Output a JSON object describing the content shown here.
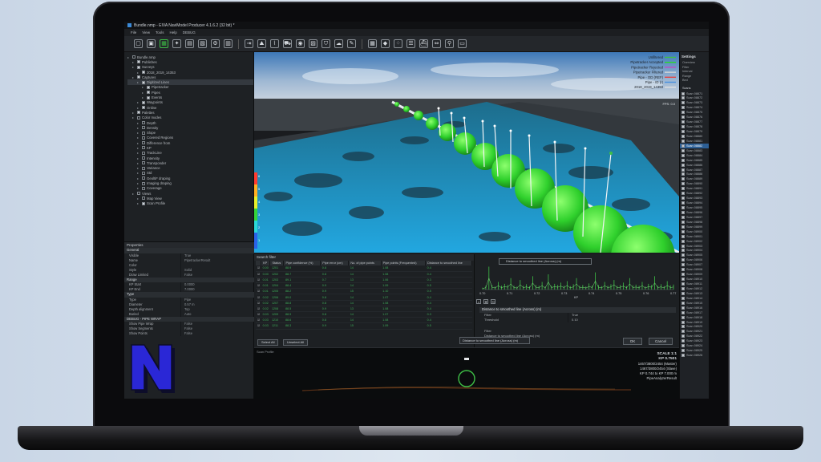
{
  "window": {
    "title": "Bundle.nmp - EIVA NaviModel Producer 4.1.6.2 (32 bit) *"
  },
  "menu": [
    "File",
    "View",
    "Tools",
    "Help",
    "DEBUG"
  ],
  "toolbar_icons": [
    "new-file-icon",
    "open-icon",
    "layers-icon",
    "satellite-icon",
    "chart-icon",
    "cube-icon",
    "settings-icon",
    "grid-icon",
    "import-icon",
    "terrain-icon",
    "profile-icon",
    "car-icon",
    "camera-icon",
    "image-icon",
    "shield-icon",
    "cloud-icon",
    "brush-icon",
    "table-icon",
    "diamond-icon",
    "dots-icon",
    "sky-icon",
    "vessel-icon",
    "measure-icon",
    "pin-icon",
    "frame-icon"
  ],
  "tree": [
    {
      "label": "Bundle.nmp",
      "level": 0,
      "check": false
    },
    {
      "label": "Publishes",
      "level": 1,
      "check": true
    },
    {
      "label": "Surveys",
      "level": 1,
      "check": true
    },
    {
      "label": "2018_2019_14353",
      "level": 2,
      "check": true
    },
    {
      "label": "Captures",
      "level": 1,
      "check": true
    },
    {
      "label": "Digitized Lines",
      "level": 2,
      "check": true,
      "selected": true
    },
    {
      "label": "Pipetracker",
      "level": 3,
      "check": true
    },
    {
      "label": "Pipes",
      "level": 3,
      "check": true
    },
    {
      "label": "Events",
      "level": 3,
      "check": true
    },
    {
      "label": "Waypoints",
      "level": 2,
      "check": true
    },
    {
      "label": "Online",
      "level": 2,
      "check": true
    },
    {
      "label": "Palettes",
      "level": 1,
      "check": true
    },
    {
      "label": "Color modes",
      "level": 1,
      "check": false
    },
    {
      "label": "Depth",
      "level": 2,
      "check": false
    },
    {
      "label": "Density",
      "level": 2,
      "check": false
    },
    {
      "label": "Slope",
      "level": 2,
      "check": false
    },
    {
      "label": "Covered Regions",
      "level": 2,
      "check": false
    },
    {
      "label": "Difference from",
      "level": 2,
      "check": false
    },
    {
      "label": "KP",
      "level": 2,
      "check": false
    },
    {
      "label": "TrackLine",
      "level": 2,
      "check": false
    },
    {
      "label": "Intensity",
      "level": 2,
      "check": false
    },
    {
      "label": "Transponder",
      "level": 2,
      "check": false
    },
    {
      "label": "Variance",
      "level": 2,
      "check": false
    },
    {
      "label": "Std",
      "level": 2,
      "check": false
    },
    {
      "label": "GeoltiF draping",
      "level": 2,
      "check": false
    },
    {
      "label": "Imaging draping",
      "level": 2,
      "check": false
    },
    {
      "label": "Coverage",
      "level": 2,
      "check": false
    },
    {
      "label": "Views",
      "level": 1,
      "check": false
    },
    {
      "label": "Map View",
      "level": 2,
      "check": false
    },
    {
      "label": "Scan Profile",
      "level": 2,
      "check": true
    }
  ],
  "properties": {
    "title": "Properties",
    "sections": [
      {
        "name": "General",
        "rows": [
          [
            "Visible",
            "True"
          ],
          [
            "Name",
            "PipetrackerResult"
          ],
          [
            "Color",
            ""
          ],
          [
            "Style",
            "Solid"
          ],
          [
            "Draw Limited",
            "False"
          ]
        ]
      },
      {
        "name": "Range",
        "rows": [
          [
            "KP Start",
            "0.0000"
          ],
          [
            "KP End",
            "7.0000"
          ]
        ]
      },
      {
        "name": "Type",
        "rows": [
          [
            "Type",
            "Pipe"
          ],
          [
            "Diameter",
            "0.57 m"
          ],
          [
            "Depth alignment",
            "Top"
          ],
          [
            "Buried",
            "Auto"
          ]
        ]
      },
      {
        "name": "DEBUG - PIPE WRAP",
        "rows": [
          [
            "Show Pipe Wrap",
            "False"
          ],
          [
            "Show Segments",
            "False"
          ],
          [
            "Show Points",
            "False"
          ]
        ]
      }
    ]
  },
  "viewport_legend": [
    "Unfiltered",
    "Pipetracker Accepted",
    "Pipetracker Rejected",
    "Pipetracker Filtered",
    "Pipe - OD (REF)",
    "Pipe - ID (r)",
    "2018_2019_14353"
  ],
  "viewport_fps": "FPS: 0.0",
  "viewport_scale_labels": [
    "6",
    "5",
    "4",
    "3",
    "2",
    "1"
  ],
  "right_panel": {
    "header": "Settings",
    "rows": [
      "Overview",
      "Filter",
      "Interval",
      "Range",
      "Bed"
    ],
    "scans_label": "Scans",
    "scans": [
      "Scan 08871",
      "Scan 08872",
      "Scan 08873",
      "Scan 08874",
      "Scan 08875",
      "Scan 08876",
      "Scan 08877",
      "Scan 08878",
      "Scan 08879",
      "Scan 08880",
      "Scan 08881",
      "Scan 08882",
      "Scan 08883",
      "Scan 08884",
      "Scan 08885",
      "Scan 08886",
      "Scan 08887",
      "Scan 08888",
      "Scan 08889",
      "Scan 08890",
      "Scan 08891",
      "Scan 08892",
      "Scan 08893",
      "Scan 08894",
      "Scan 08895",
      "Scan 08896",
      "Scan 08897",
      "Scan 08898",
      "Scan 08899",
      "Scan 08900",
      "Scan 08901",
      "Scan 08902",
      "Scan 08903",
      "Scan 08904",
      "Scan 08905",
      "Scan 08906",
      "Scan 08907",
      "Scan 08908",
      "Scan 08909",
      "Scan 08910",
      "Scan 08911",
      "Scan 08912",
      "Scan 08913",
      "Scan 08914",
      "Scan 08915",
      "Scan 08916",
      "Scan 08917",
      "Scan 08918",
      "Scan 08919",
      "Scan 08920",
      "Scan 08921",
      "Scan 08922",
      "Scan 08923",
      "Scan 08924",
      "Scan 08925",
      "Scan 08926"
    ]
  },
  "search_filter": {
    "title": "Search filter",
    "columns": [
      "KP",
      "Status",
      "Pipe confidence (%)",
      "Pipe error (cm)",
      "No. of pipe points",
      "Pipe points (Frequented)",
      "Distance to smoothed line"
    ],
    "rows": [
      [
        "0.00",
        "1201",
        "88.9",
        "0.8",
        "14",
        "1.08",
        "0.4"
      ],
      [
        "0.00",
        "1202",
        "88.7",
        "0.8",
        "14",
        "1.08",
        "0.4"
      ],
      [
        "0.01",
        "1203",
        "89.1",
        "0.7",
        "13",
        "1.06",
        "0.3"
      ],
      [
        "0.01",
        "1204",
        "88.4",
        "0.9",
        "14",
        "1.09",
        "0.5"
      ],
      [
        "0.01",
        "1205",
        "88.2",
        "0.9",
        "15",
        "1.10",
        "0.5"
      ],
      [
        "0.02",
        "1206",
        "89.0",
        "0.8",
        "14",
        "1.07",
        "0.4"
      ],
      [
        "0.02",
        "1207",
        "88.8",
        "0.8",
        "14",
        "1.08",
        "0.4"
      ],
      [
        "0.02",
        "1208",
        "88.5",
        "0.9",
        "13",
        "1.08",
        "0.4"
      ],
      [
        "0.03",
        "1209",
        "88.9",
        "0.8",
        "14",
        "1.07",
        "0.3"
      ],
      [
        "0.03",
        "1210",
        "88.6",
        "0.8",
        "14",
        "1.08",
        "0.4"
      ],
      [
        "0.03",
        "1211",
        "88.3",
        "0.9",
        "15",
        "1.09",
        "0.5"
      ]
    ],
    "select_all": "Select All",
    "unselect_all": "Unselect All"
  },
  "graph": {
    "legend": "Distance to smoothed line (Across) (m)",
    "x_ticks": [
      "0.70",
      "0.71",
      "0.72",
      "0.73",
      "0.74",
      "0.75",
      "0.76",
      "0.77"
    ],
    "x_label": "KP",
    "values": [
      0.05,
      0.1,
      0.6,
      0.12,
      0.08,
      0.2,
      0.1,
      0.15,
      0.12,
      0.3,
      0.1,
      0.08,
      0.25,
      0.1,
      0.14,
      0.09,
      0.35,
      0.12,
      0.1,
      0.2,
      0.08,
      0.4,
      0.1,
      0.15,
      0.12,
      0.18,
      0.1,
      0.22,
      0.09,
      0.14,
      0.3,
      0.1,
      0.12,
      0.08,
      0.16,
      0.1,
      0.45,
      0.12,
      0.09,
      0.2,
      0.1,
      0.14,
      0.25,
      0.1,
      0.12,
      0.18,
      0.09,
      0.3,
      0.11,
      0.13,
      0.1,
      0.2,
      0.08,
      0.15,
      0.12,
      0.35,
      0.1,
      0.14,
      0.09,
      0.22,
      0.11,
      0.13
    ]
  },
  "filter_form": {
    "section": "Distance to smoothed line (Across) (m)",
    "rows": [
      [
        "Filter",
        "True"
      ],
      [
        "Threshold",
        "0.10"
      ]
    ],
    "filter_label": "Filter",
    "filter_desc": "Distance to smoothed line (Across) (m)",
    "select_value": "Distance to smoothed line (Across) (m)",
    "ok": "OK",
    "cancel": "Cancel"
  },
  "scan_view": {
    "title": "Scan Profile",
    "info": [
      "SCALE 1:1",
      "KP 0.7501",
      "1467/3800/2454 (Master)",
      "1467/3800/2454 (Slave)",
      "KP 0.744 to KP 7.000 m",
      "PipeAnalyzerResult"
    ]
  },
  "colors": {
    "accent_green": "#3ec046",
    "selection_blue": "#2d5f95",
    "pipe_green": "#31d62f"
  }
}
